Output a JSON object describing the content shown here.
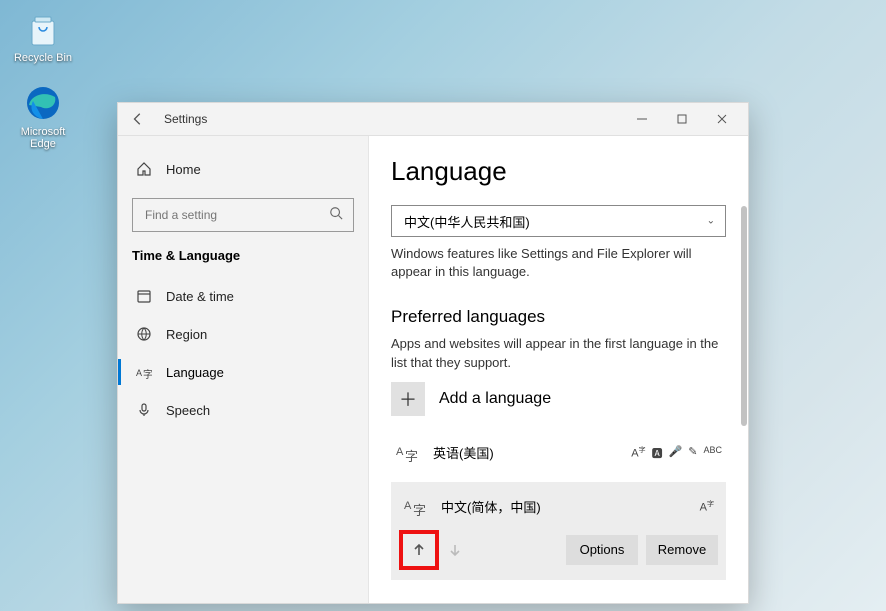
{
  "desktop": {
    "recycle_label": "Recycle Bin",
    "edge_label": "Microsoft Edge"
  },
  "window": {
    "title": "Settings"
  },
  "sidebar": {
    "home": "Home",
    "search_placeholder": "Find a setting",
    "subhead": "Time & Language",
    "items": [
      {
        "label": "Date & time"
      },
      {
        "label": "Region"
      },
      {
        "label": "Language"
      },
      {
        "label": "Speech"
      }
    ]
  },
  "main": {
    "heading": "Language",
    "display_lang": "中文(中华人民共和国)",
    "display_desc": "Windows features like Settings and File Explorer will appear in this language.",
    "pref_heading": "Preferred languages",
    "pref_desc": "Apps and websites will appear in the first language in the list that they support.",
    "add_label": "Add a language",
    "langs": [
      {
        "name": "英语(美国)"
      },
      {
        "name": "中文(简体，中国)"
      }
    ],
    "options_btn": "Options",
    "remove_btn": "Remove"
  }
}
